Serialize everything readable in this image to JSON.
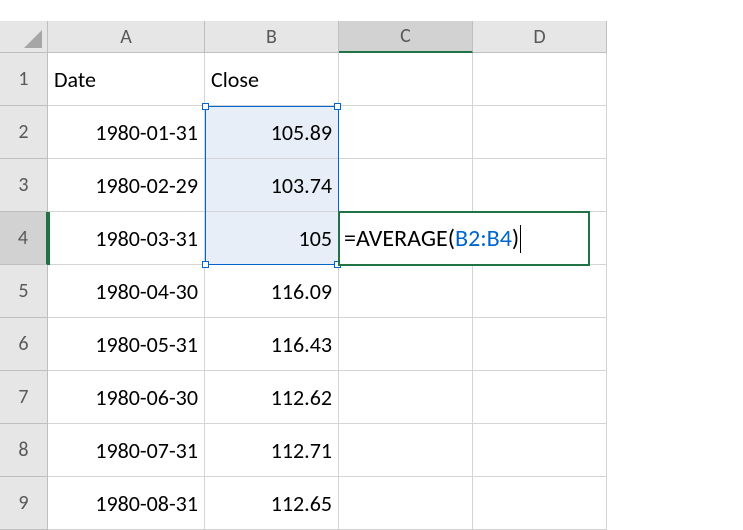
{
  "columns": [
    "A",
    "B",
    "C",
    "D"
  ],
  "row_numbers": [
    "1",
    "2",
    "3",
    "4",
    "5",
    "6",
    "7",
    "8",
    "9"
  ],
  "headers": {
    "a": "Date",
    "b": "Close"
  },
  "rows": [
    {
      "date": "1980-01-31",
      "close": "105.89"
    },
    {
      "date": "1980-02-29",
      "close": "103.74"
    },
    {
      "date": "1980-03-31",
      "close": "105"
    },
    {
      "date": "1980-04-30",
      "close": "116.09"
    },
    {
      "date": "1980-05-31",
      "close": "116.43"
    },
    {
      "date": "1980-06-30",
      "close": "112.62"
    },
    {
      "date": "1980-07-31",
      "close": "112.71"
    },
    {
      "date": "1980-08-31",
      "close": "112.65"
    }
  ],
  "formula": {
    "prefix": "=AVERAGE(",
    "ref": "B2:B4",
    "suffix": ")"
  },
  "active_cell": "C4",
  "selected_range": "B2:B4"
}
